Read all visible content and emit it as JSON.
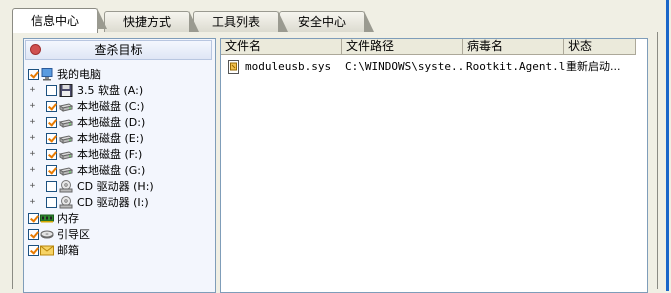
{
  "tabs": [
    "信息中心",
    "快捷方式",
    "工具列表",
    "安全中心"
  ],
  "left": {
    "kill_button": "查杀目标",
    "tree": [
      {
        "label": "我的电脑",
        "checked": true,
        "icon": "computer-icon",
        "expand": false
      },
      {
        "label": "3.5 软盘 (A:)",
        "checked": false,
        "icon": "floppy-icon",
        "expand": true
      },
      {
        "label": "本地磁盘 (C:)",
        "checked": true,
        "icon": "harddisk-icon",
        "expand": true
      },
      {
        "label": "本地磁盘 (D:)",
        "checked": true,
        "icon": "harddisk-icon",
        "expand": true
      },
      {
        "label": "本地磁盘 (E:)",
        "checked": true,
        "icon": "harddisk-icon",
        "expand": true
      },
      {
        "label": "本地磁盘 (F:)",
        "checked": true,
        "icon": "harddisk-icon",
        "expand": true
      },
      {
        "label": "本地磁盘 (G:)",
        "checked": true,
        "icon": "harddisk-icon",
        "expand": true
      },
      {
        "label": "CD 驱动器 (H:)",
        "checked": false,
        "icon": "cd-drive-icon",
        "expand": true
      },
      {
        "label": "CD 驱动器 (I:)",
        "checked": false,
        "icon": "cd-drive-icon",
        "expand": true
      },
      {
        "label": "内存",
        "checked": true,
        "icon": "memory-icon",
        "expand": false
      },
      {
        "label": "引导区",
        "checked": true,
        "icon": "bootsector-icon",
        "expand": false
      },
      {
        "label": "邮箱",
        "checked": true,
        "icon": "mail-icon",
        "expand": false
      }
    ]
  },
  "table": {
    "columns": [
      "文件名",
      "文件路径",
      "病毒名",
      "状态"
    ],
    "rows": [
      {
        "file": "moduleusb.sys",
        "path": "C:\\WINDOWS\\syste...",
        "virus": "Rootkit.Agent.lk",
        "status": "重新启动..."
      }
    ]
  },
  "colors": {
    "accent": "#1a66c9",
    "check": "#e87a00",
    "panel_border": "#7f9db9"
  }
}
